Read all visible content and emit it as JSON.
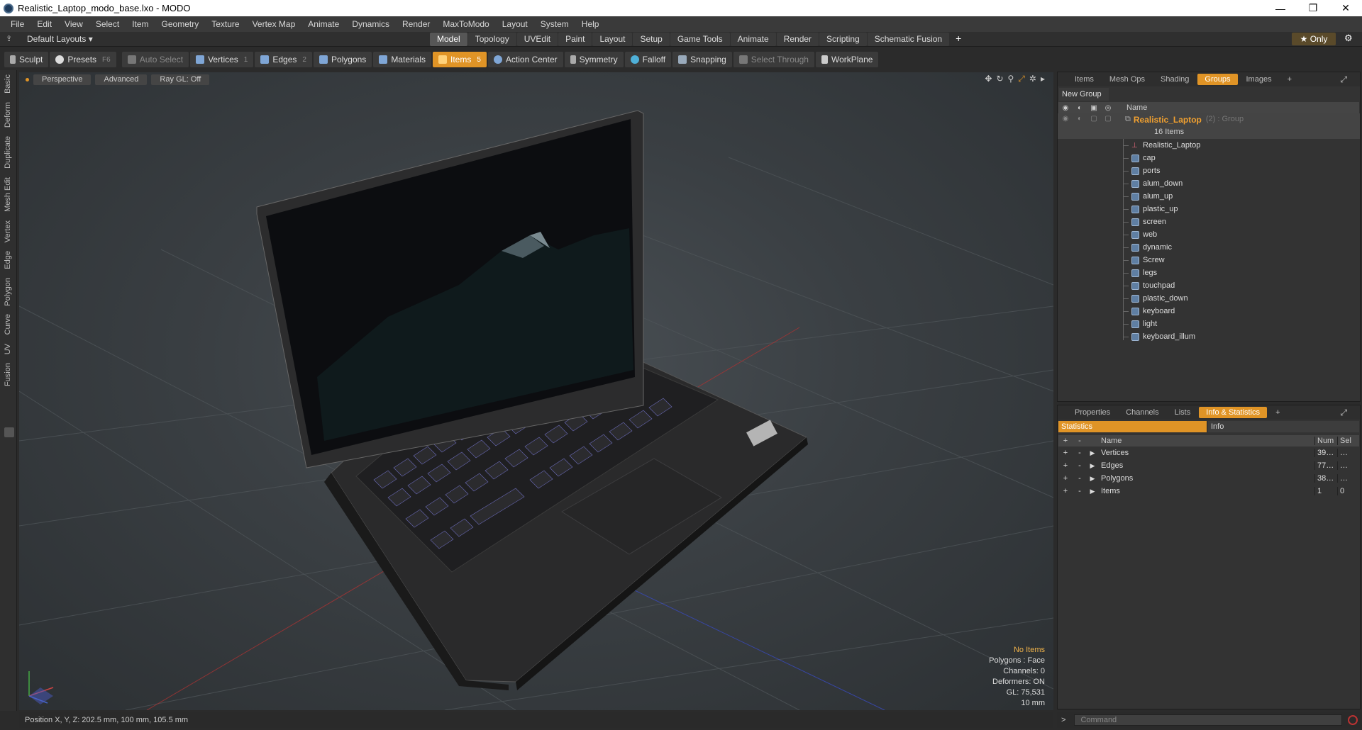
{
  "window": {
    "title": "Realistic_Laptop_modo_base.lxo - MODO",
    "controls": [
      "—",
      "❐",
      "✕"
    ]
  },
  "menu": [
    "File",
    "Edit",
    "View",
    "Select",
    "Item",
    "Geometry",
    "Texture",
    "Vertex Map",
    "Animate",
    "Dynamics",
    "Render",
    "MaxToModo",
    "Layout",
    "System",
    "Help"
  ],
  "layoutbar": {
    "layout_select": "Default Layouts ▾",
    "tabs": [
      "Model",
      "Topology",
      "UVEdit",
      "Paint",
      "Layout",
      "Setup",
      "Game Tools",
      "Animate",
      "Render",
      "Scripting",
      "Schematic Fusion"
    ],
    "active_tab": "Model",
    "plus": "+",
    "only_label": "★  Only"
  },
  "toolbar": {
    "sculpt": "Sculpt",
    "presets": "Presets",
    "presets_key": "F6",
    "auto_select": "Auto Select",
    "vertices": "Vertices",
    "vertices_key": "1",
    "edges": "Edges",
    "edges_key": "2",
    "polygons": "Polygons",
    "materials": "Materials",
    "items": "Items",
    "items_key": "5",
    "action_center": "Action Center",
    "symmetry": "Symmetry",
    "falloff": "Falloff",
    "snapping": "Snapping",
    "select_through": "Select Through",
    "workplane": "WorkPlane"
  },
  "lefttabs": [
    "Basic",
    "Deform",
    "Duplicate",
    "Mesh Edit",
    "Vertex",
    "Edge",
    "Polygon",
    "Curve",
    "UV",
    "Fusion"
  ],
  "viewport": {
    "view_mode": "Perspective",
    "shading": "Advanced",
    "raygl": "Ray GL: Off",
    "info": {
      "no_items": "No Items",
      "polygons": "Polygons : Face",
      "channels": "Channels: 0",
      "deformers": "Deformers: ON",
      "gl": "GL: 75,531",
      "scale": "10 mm"
    }
  },
  "status": {
    "position": "Position X, Y, Z:   202.5 mm, 100 mm, 105.5 mm"
  },
  "top_panel": {
    "tabs": [
      "Items",
      "Mesh Ops",
      "Shading",
      "Groups",
      "Images"
    ],
    "active_tab": "Groups",
    "new_group": "New Group",
    "header_name": "Name",
    "group_name": "Realistic_Laptop",
    "group_meta": "(2) : Group",
    "group_count": "16 Items",
    "items": [
      "Realistic_Laptop",
      "cap",
      "ports",
      "alum_down",
      "alum_up",
      "plastic_up",
      "screen",
      "web",
      "dynamic",
      "Screw",
      "legs",
      "touchpad",
      "plastic_down",
      "keyboard",
      "light",
      "keyboard_illum"
    ]
  },
  "bottom_panel": {
    "tabs": [
      "Properties",
      "Channels",
      "Lists",
      "Info & Statistics"
    ],
    "active_tab": "Info & Statistics",
    "subtabs": [
      "Statistics",
      "Info"
    ],
    "columns": [
      "Name",
      "Num",
      "Sel"
    ],
    "rows": [
      {
        "name": "Vertices",
        "num": "39…",
        "sel": "…"
      },
      {
        "name": "Edges",
        "num": "77…",
        "sel": "…"
      },
      {
        "name": "Polygons",
        "num": "38…",
        "sel": "…"
      },
      {
        "name": "Items",
        "num": "1",
        "sel": "0"
      }
    ]
  },
  "command": {
    "prompt": ">",
    "placeholder": "Command"
  },
  "colors": {
    "accent": "#e09426",
    "group_title": "#f0a030",
    "bg": "#2b2b2b"
  }
}
